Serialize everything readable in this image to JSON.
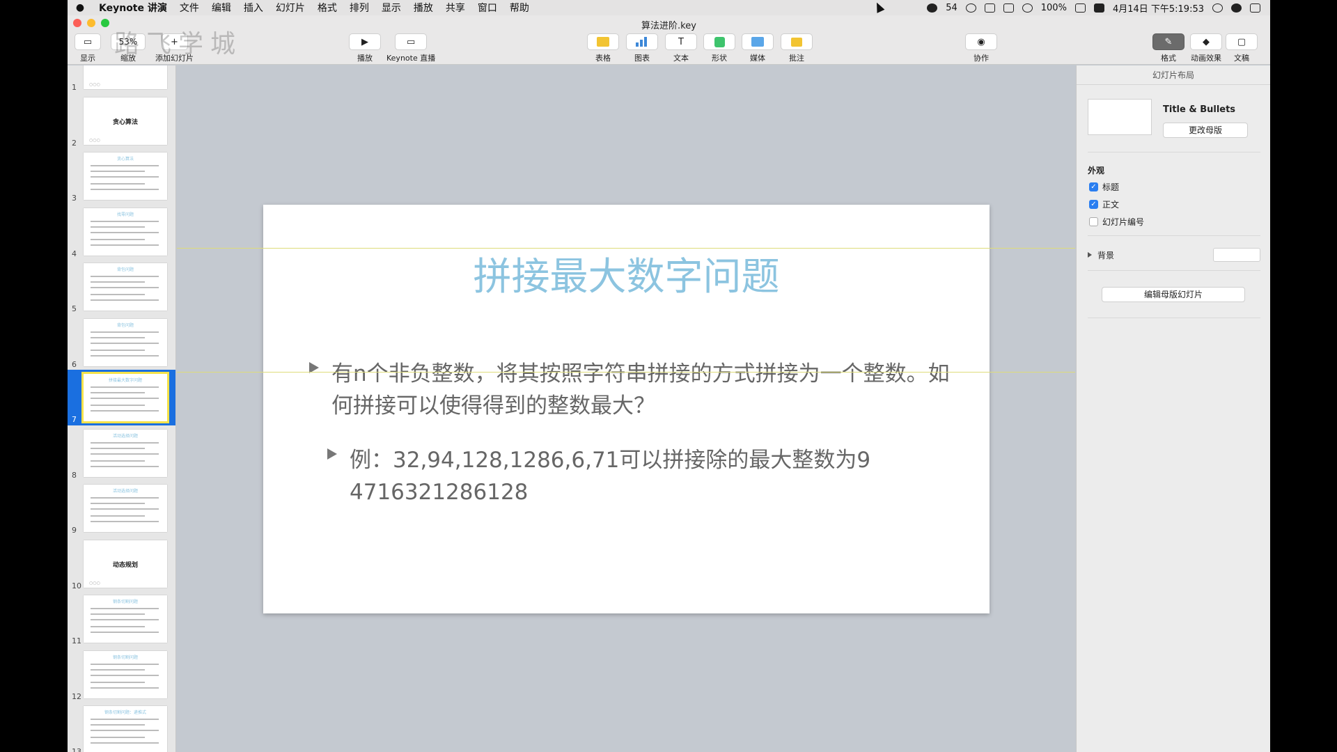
{
  "menubar": {
    "app": "Keynote 讲演",
    "items": [
      "文件",
      "编辑",
      "插入",
      "幻灯片",
      "格式",
      "排列",
      "显示",
      "播放",
      "共享",
      "窗口",
      "帮助"
    ],
    "notifications": "54",
    "battery": "100%",
    "datetime": "4月14日 下午5:19:53"
  },
  "window": {
    "title": "算法进阶.key"
  },
  "watermark": "路飞学城",
  "toolbar": {
    "view": "显示",
    "zoom_value": "53%",
    "zoom": "缩放",
    "add_slide": "添加幻灯片",
    "play": "播放",
    "live": "Keynote 直播",
    "table": "表格",
    "chart": "图表",
    "text": "文本",
    "shape": "形状",
    "media": "媒体",
    "comment": "批注",
    "collaborate": "协作",
    "format": "格式",
    "animate": "动画效果",
    "document": "文稿"
  },
  "navigator": {
    "slides": [
      {
        "num": "1",
        "title": "",
        "bold": ""
      },
      {
        "num": "2",
        "title": "",
        "bold": "贪心算法"
      },
      {
        "num": "3",
        "title": "贪心算法",
        "bold": ""
      },
      {
        "num": "4",
        "title": "找零问题",
        "bold": ""
      },
      {
        "num": "5",
        "title": "背包问题",
        "bold": ""
      },
      {
        "num": "6",
        "title": "背包问题",
        "bold": ""
      },
      {
        "num": "7",
        "title": "拼接最大数字问题",
        "bold": ""
      },
      {
        "num": "8",
        "title": "活动选择问题",
        "bold": ""
      },
      {
        "num": "9",
        "title": "活动选择问题",
        "bold": ""
      },
      {
        "num": "10",
        "title": "",
        "bold": "动态规划"
      },
      {
        "num": "11",
        "title": "钢条切割问题",
        "bold": ""
      },
      {
        "num": "12",
        "title": "钢条切割问题",
        "bold": ""
      },
      {
        "num": "13",
        "title": "钢条切割问题：递推式",
        "bold": ""
      }
    ],
    "selected": "7"
  },
  "slide": {
    "title": "拼接最大数字问题",
    "bullet1": "有n个非负整数，将其按照字符串拼接的方式拼接为一个整数。如何拼接可以使得得到的整数最大？",
    "bullet2": "例：32,94,128,1286,6,71可以拼接除的最大整数为94716321286128"
  },
  "inspector": {
    "header": "幻灯片布局",
    "layout_name": "Title & Bullets",
    "change_master": "更改母版",
    "appearance": "外观",
    "title_cb": "标题",
    "body_cb": "正文",
    "number_cb": "幻灯片编号",
    "background": "背景",
    "edit_master": "编辑母版幻灯片"
  }
}
